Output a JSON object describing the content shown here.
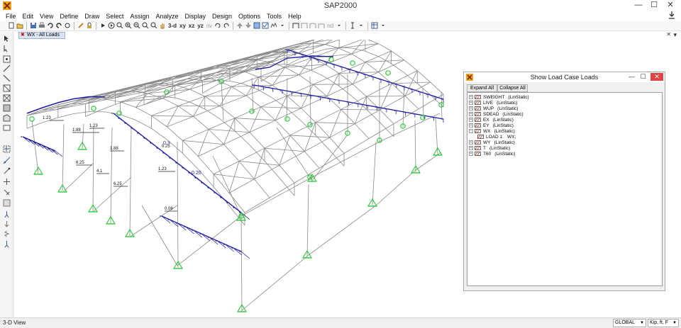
{
  "window": {
    "title": "SAP2000",
    "minimize": "—",
    "maximize": "☐",
    "close": "✕"
  },
  "menu": [
    "File",
    "Edit",
    "View",
    "Define",
    "Draw",
    "Select",
    "Assign",
    "Analyze",
    "Display",
    "Design",
    "Options",
    "Tools",
    "Help"
  ],
  "toolbar": {
    "view3d": "3-d",
    "xy": "xy",
    "xz": "xz",
    "yz": "yz",
    "nv": "nv",
    "nd": "nd"
  },
  "tab": {
    "label": "WX - All Loads",
    "pin": "▾",
    "close": "✕"
  },
  "dialog": {
    "title": "Show Load Case Loads",
    "expand_all": "Expand All",
    "collapse_all": "Collapse All",
    "rows": [
      {
        "name": "SWEIGHT",
        "type": "(LinStatic)",
        "sign": "+"
      },
      {
        "name": "LIVE",
        "type": "(LinStatic)",
        "sign": "+"
      },
      {
        "name": "WUP",
        "type": "(LinStatic)",
        "sign": "+"
      },
      {
        "name": "SDEAD",
        "type": "(LinStatic)",
        "sign": "+"
      },
      {
        "name": "EX",
        "type": "(LinStatic)",
        "sign": "+"
      },
      {
        "name": "EY",
        "type": "(LinStatic)",
        "sign": "+"
      },
      {
        "name": "WX",
        "type": "(LinStatic)",
        "sign": "−"
      },
      {
        "name": "LOAD 1:",
        "type": "WX;",
        "sign": ""
      },
      {
        "name": "WY",
        "type": "(LinStatic)",
        "sign": "+"
      },
      {
        "name": "T",
        "type": "(LinStatic)",
        "sign": "+"
      },
      {
        "name": "T60",
        "type": "(LinStatic)",
        "sign": "+"
      }
    ]
  },
  "load_labels": [
    "1.23",
    "1.88",
    "1.23",
    "1.88",
    "6.25",
    "4.1",
    "6.25",
    "0.25",
    "0.3",
    "1.23",
    "0.20",
    "0.08"
  ],
  "status": {
    "view": "3-D View",
    "coord": "GLOBAL",
    "units": "Kip, ft, F"
  },
  "colors": {
    "frame": "#8a8a8a",
    "load": "#1f1fa0",
    "support": "#2ec83a",
    "close": "#e04343"
  }
}
